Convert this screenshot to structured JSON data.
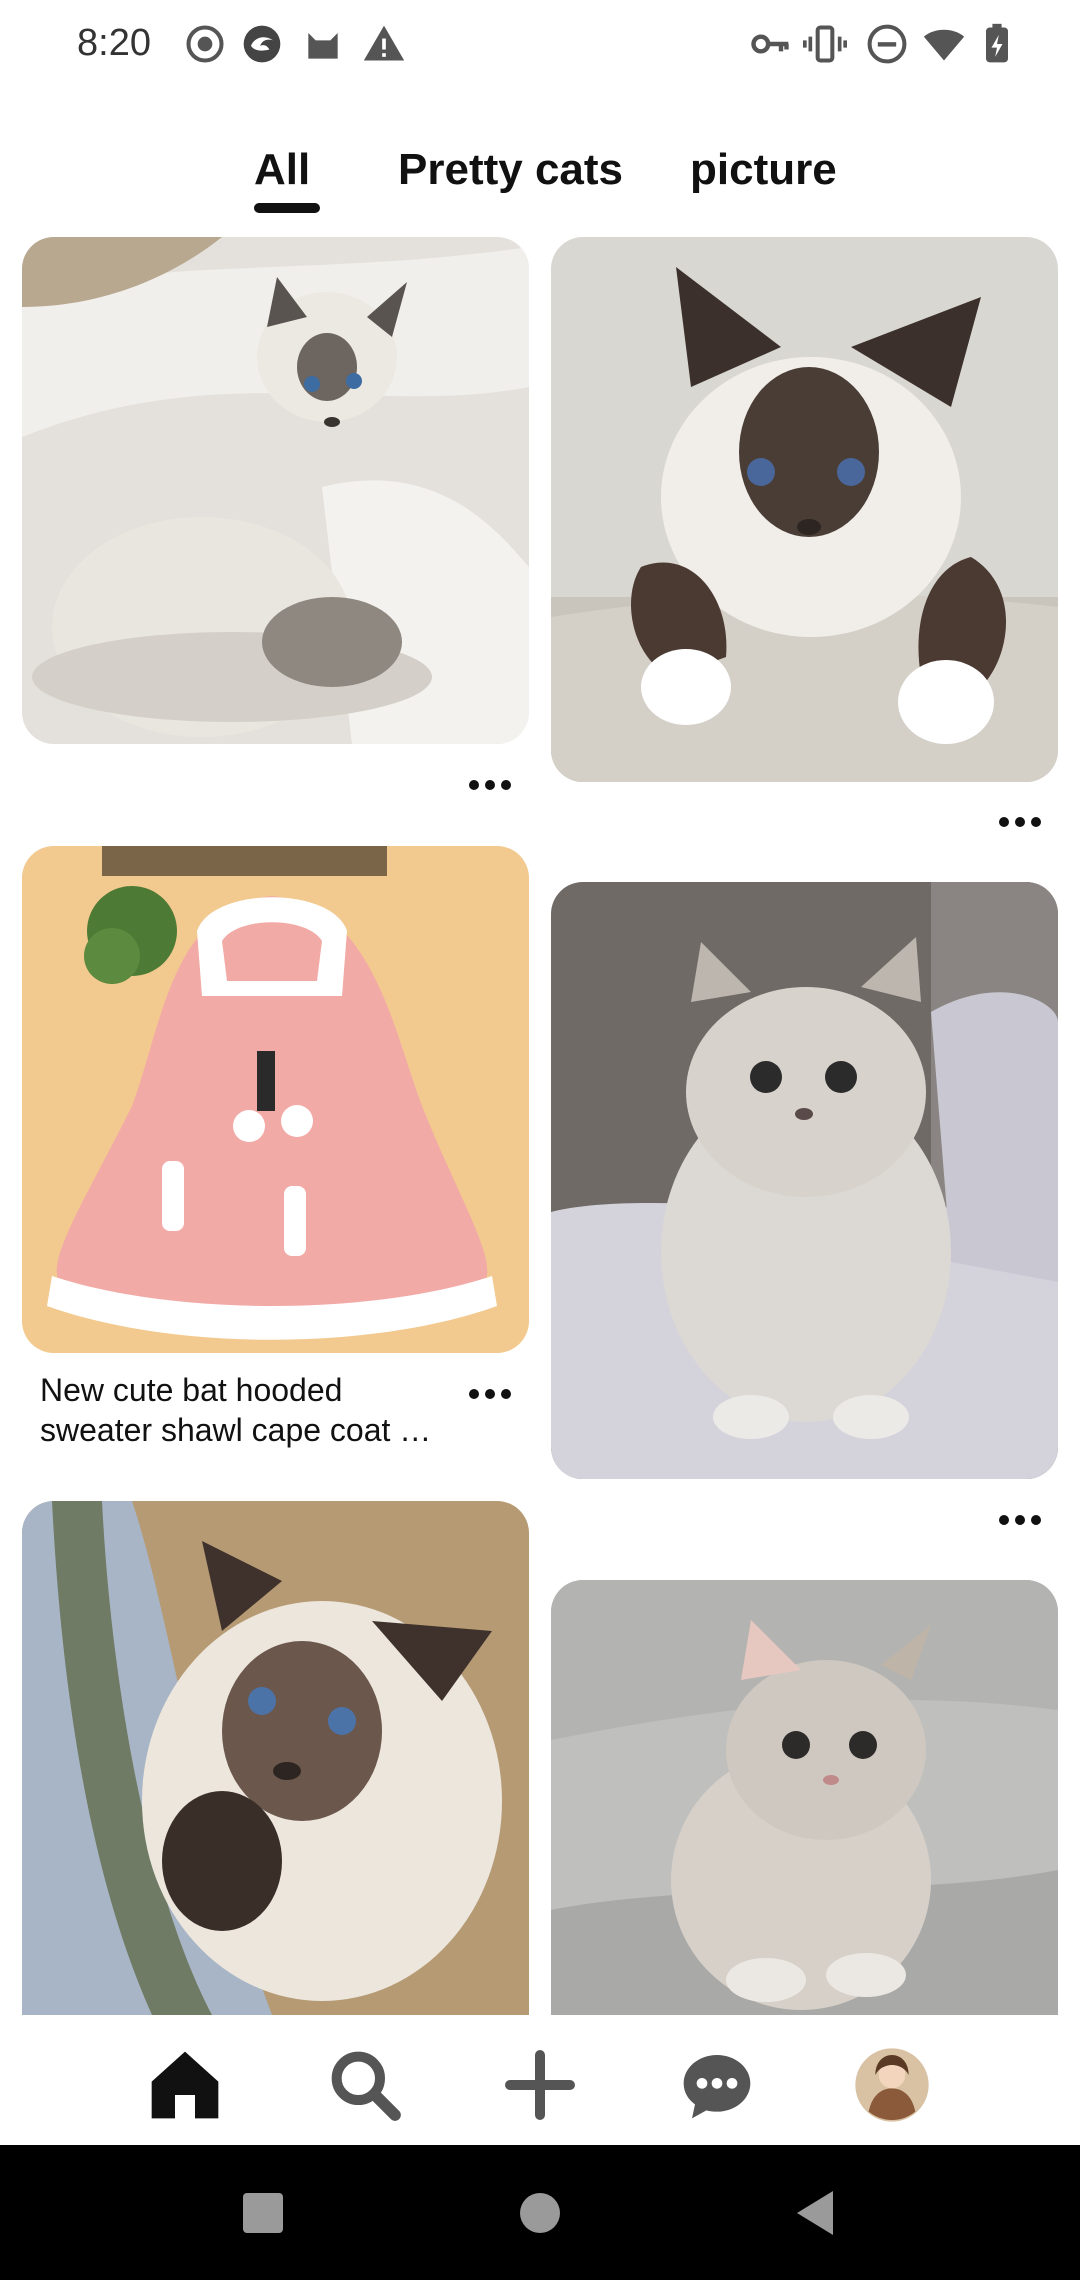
{
  "status_bar": {
    "time": "8:20",
    "left_icons": [
      "record-icon",
      "app-icon",
      "cat-icon",
      "warning-icon"
    ],
    "right_icons": [
      "key-icon",
      "vibrate-icon",
      "dnd-icon",
      "wifi-icon",
      "battery-icon"
    ]
  },
  "tabs": [
    {
      "label": "All",
      "selected": true
    },
    {
      "label": "Pretty cats",
      "selected": false
    },
    {
      "label": "picture",
      "selected": false
    }
  ],
  "feed": {
    "pins": [
      {
        "id": "pin-1",
        "subject": "siamese-kitten-on-bed"
      },
      {
        "id": "pin-2",
        "subject": "siamese-cat-on-perch"
      },
      {
        "id": "pin-3",
        "subject": "pink-hooded-cape",
        "caption_line1": "New cute bat hooded",
        "caption_line2": "sweater shawl cape coat  …"
      },
      {
        "id": "pin-4",
        "subject": "fluffy-grey-kitten-on-bed"
      },
      {
        "id": "pin-5",
        "subject": "ragdoll-kitten-on-pillow"
      },
      {
        "id": "pin-6",
        "subject": "grey-kitten-on-sofa"
      }
    ]
  },
  "bottom_nav": [
    "home-icon",
    "search-icon",
    "add-icon",
    "messages-icon",
    "profile-avatar"
  ],
  "colors": {
    "text": "#111111",
    "background": "#ffffff",
    "system_nav": "#000000"
  }
}
